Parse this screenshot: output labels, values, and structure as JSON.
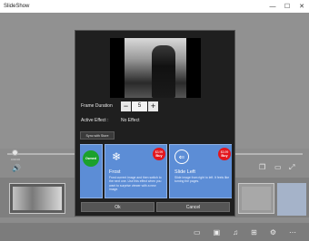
{
  "window": {
    "title": "SlideShow",
    "minimize_glyph": "—",
    "maximize_glyph": "☐",
    "close_glyph": "✕"
  },
  "background": {
    "time_label": "0:00:00",
    "volume_icon": "speaker-icon",
    "toolbar_icons": [
      "copy-icon",
      "split-icon",
      "fullscreen-icon"
    ],
    "bottom_icons": [
      "add-media-icon",
      "preview-icon",
      "music-icon",
      "text-icon",
      "settings-icon",
      "more-icon"
    ]
  },
  "dialog": {
    "frame_duration_label": "Frame Duration",
    "frame_duration_value": "5",
    "minus_label": "−",
    "plus_label": "+",
    "active_effect_label": "Active Effect :",
    "active_effect_value": "No Effect",
    "sync_button_label": "Sync with Store",
    "effects": [
      {
        "badge": "Owned",
        "name": "",
        "description": ""
      },
      {
        "name": "Frost",
        "icon": "snowflake-icon",
        "price": "$3.99",
        "buy_label": "Buy",
        "description": "Frost current image and then switch to the next one. Use this effect when you want to surprise viewer with a new image."
      },
      {
        "name": "Slide Left",
        "icon": "slide-left-icon",
        "price": "$3.99",
        "buy_label": "Buy",
        "description": "Slide image from right to left. It feels like turning the pages."
      }
    ],
    "ok_label": "Ok",
    "cancel_label": "Cancel"
  },
  "colors": {
    "dialog_bg": "#1f1f1f",
    "card_blue": "#5c8dd6",
    "owned_green": "#1ba12b",
    "buy_red": "#e3161d"
  }
}
